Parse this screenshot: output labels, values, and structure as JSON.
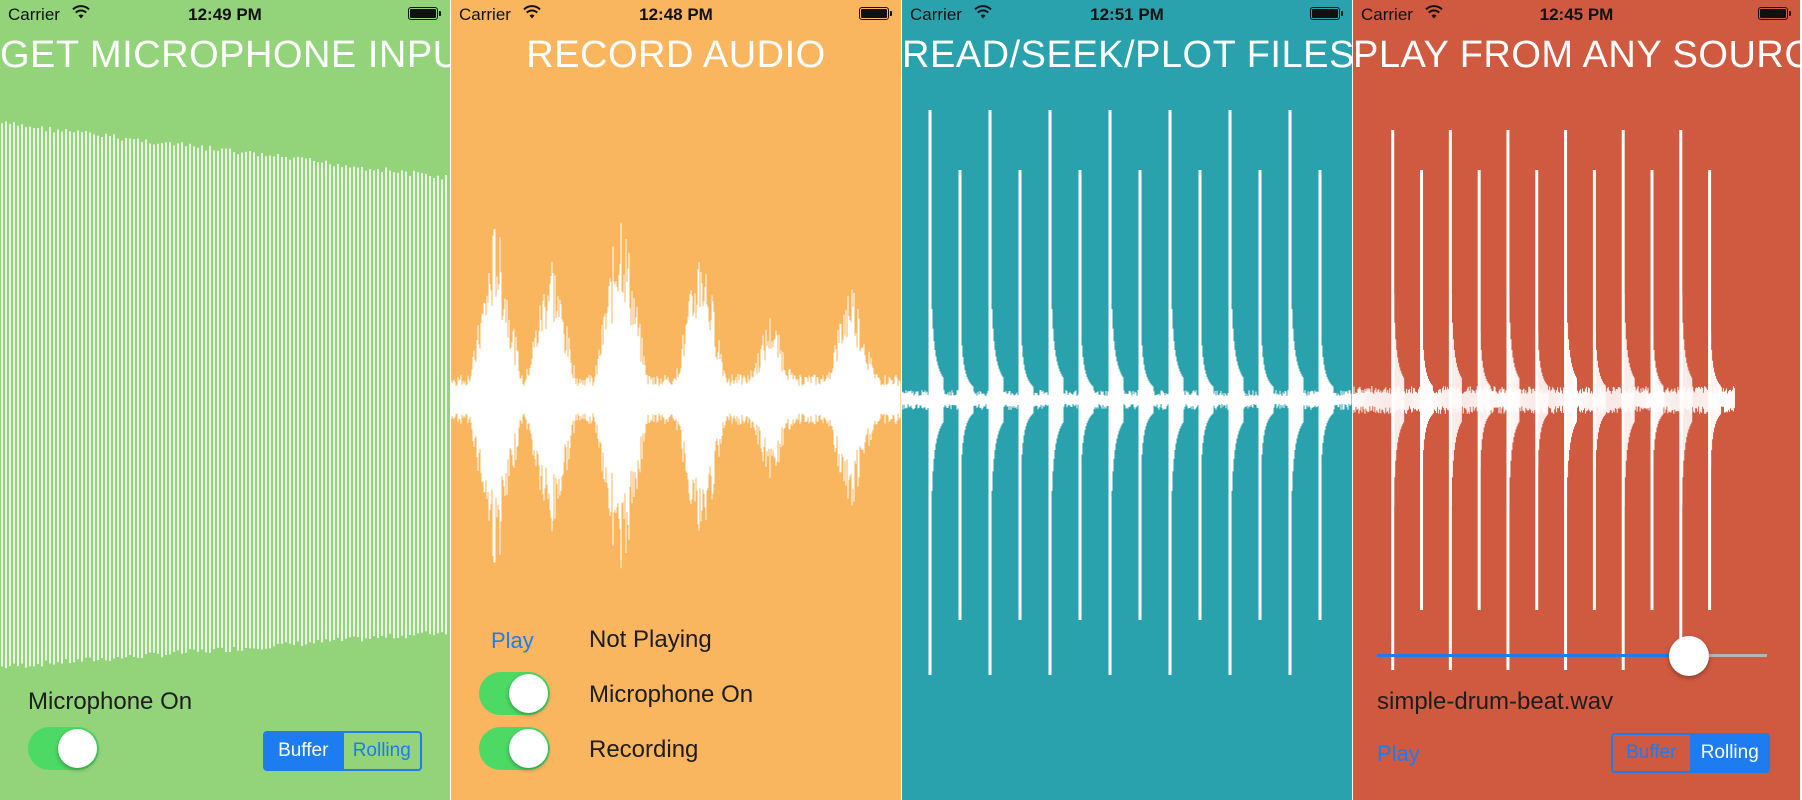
{
  "colors": {
    "panel1": "#93d37a",
    "panel2": "#f9b65f",
    "panel3": "#2aa2ad",
    "panel4": "#d05a40",
    "accent": "#1c7cf0",
    "toggle_on": "#4cd964"
  },
  "panels": [
    {
      "status": {
        "carrier": "Carrier",
        "time": "12:49 PM"
      },
      "title": "GET MICROPHONE INPUT",
      "microphone_label": "Microphone On",
      "microphone_on": true,
      "segmented": {
        "options": [
          "Buffer",
          "Rolling"
        ],
        "selected": "Buffer"
      }
    },
    {
      "status": {
        "carrier": "Carrier",
        "time": "12:48 PM"
      },
      "title": "RECORD AUDIO",
      "play_label": "Play",
      "playback_status": "Not Playing",
      "microphone_label": "Microphone On",
      "microphone_on": true,
      "recording_label": "Recording",
      "recording_on": true
    },
    {
      "status": {
        "carrier": "Carrier",
        "time": "12:51 PM"
      },
      "title": "READ/SEEK/PLOT FILES"
    },
    {
      "status": {
        "carrier": "Carrier",
        "time": "12:45 PM"
      },
      "title": "PLAY FROM ANY SOURCE",
      "seek_position": 0.8,
      "file_name": "simple-drum-beat.wav",
      "play_label": "Play",
      "segmented": {
        "options": [
          "Buffer",
          "Rolling"
        ],
        "selected": "Rolling"
      }
    }
  ],
  "icons": [
    "wifi-icon",
    "battery-icon"
  ]
}
